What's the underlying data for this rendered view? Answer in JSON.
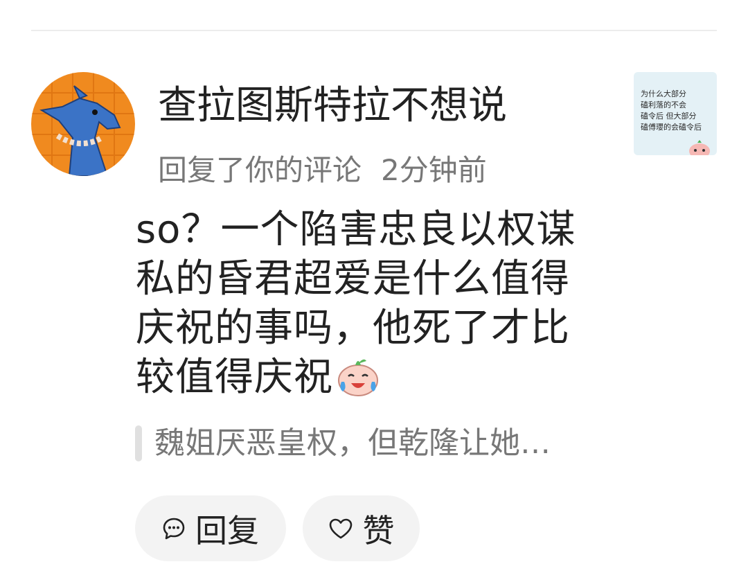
{
  "comment": {
    "username": "查拉图斯特拉不想说",
    "action": "回复了你的评论",
    "time": "2分钟前",
    "text": "so？一个陷害忠良以权谋私的昏君超爱是什么值得庆祝的事吗，他死了才比较值得庆祝",
    "emoji": "crying-laughing-peach-emoji",
    "quoted_text": "魏姐厌恶皇权，但乾隆让她…",
    "thumbnail_lines": [
      "为什么大部分",
      "磕利落的不会",
      "磕令后 但大部分",
      "磕傅瓔的会磕令后"
    ]
  },
  "actions": {
    "reply_label": "回复",
    "reply_icon": "speech-bubble-icon",
    "like_label": "赞",
    "like_icon": "heart-icon"
  }
}
